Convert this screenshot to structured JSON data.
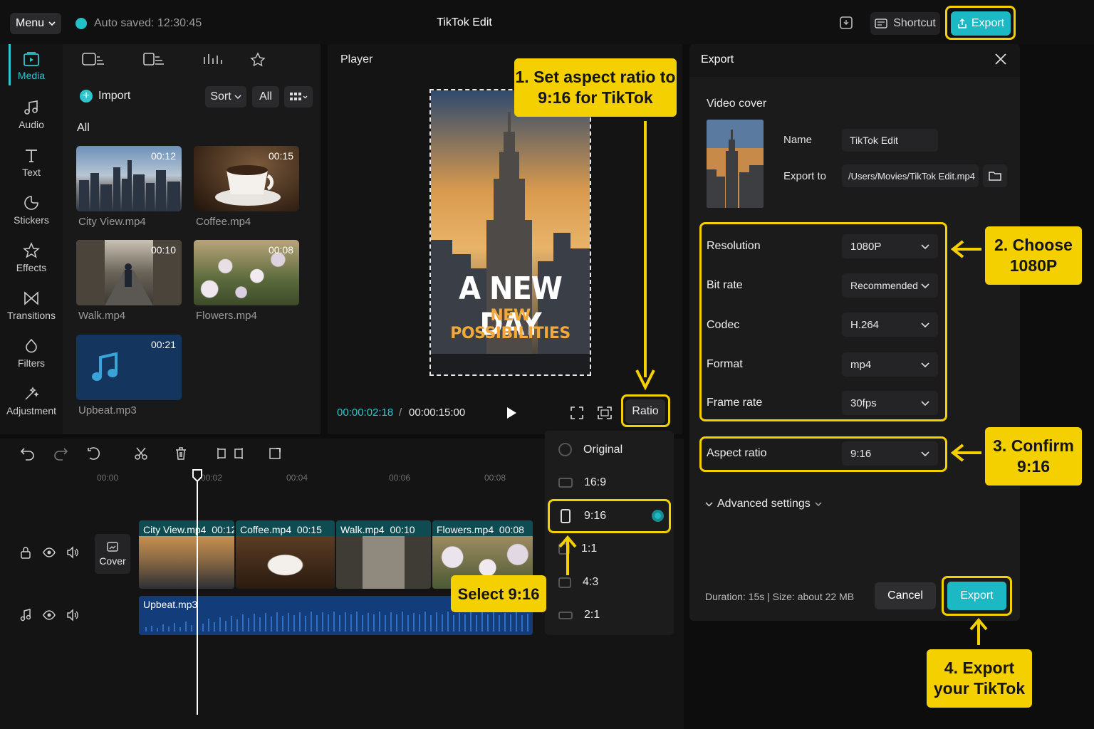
{
  "topbar": {
    "menu_label": "Menu",
    "autosave": "Auto saved: 12:30:45",
    "title": "TikTok Edit",
    "shortcut_label": "Shortcut",
    "export_label": "Export"
  },
  "sidebar": {
    "items": [
      {
        "label": "Media",
        "icon": "media-icon"
      },
      {
        "label": "Audio",
        "icon": "audio-icon"
      },
      {
        "label": "Text",
        "icon": "text-icon"
      },
      {
        "label": "Stickers",
        "icon": "stickers-icon"
      },
      {
        "label": "Effects",
        "icon": "effects-icon"
      },
      {
        "label": "Transitions",
        "icon": "transitions-icon"
      },
      {
        "label": "Filters",
        "icon": "filters-icon"
      },
      {
        "label": "Adjustment",
        "icon": "adjustment-icon"
      }
    ]
  },
  "media": {
    "import_label": "Import",
    "sort_label": "Sort",
    "all_filter": "All",
    "section_label": "All",
    "items": [
      {
        "name": "City View.mp4",
        "duration": "00:12"
      },
      {
        "name": "Coffee.mp4",
        "duration": "00:15"
      },
      {
        "name": "Walk.mp4",
        "duration": "00:10"
      },
      {
        "name": "Flowers.mp4",
        "duration": "00:08"
      },
      {
        "name": "Upbeat.mp3",
        "duration": "00:21"
      }
    ]
  },
  "player": {
    "title": "Player",
    "headline": "A NEW DAY",
    "subline": "NEW POSSIBILITIES",
    "current_time": "00:00:02:18",
    "separator": "/",
    "total_time": "00:00:15:00",
    "ratio_label": "Ratio"
  },
  "ratio_menu": {
    "options": [
      "Original",
      "16:9",
      "9:16",
      "1:1",
      "4:3",
      "2:1"
    ],
    "selected": "9:16"
  },
  "export": {
    "title": "Export",
    "video_cover_label": "Video cover",
    "name_label": "Name",
    "name_value": "TikTok Edit",
    "export_to_label": "Export to",
    "export_to_value": "/Users/Movies/TikTok Edit.mp4",
    "settings": [
      {
        "label": "Resolution",
        "value": "1080P"
      },
      {
        "label": "Bit rate",
        "value": "Recommended"
      },
      {
        "label": "Codec",
        "value": "H.264"
      },
      {
        "label": "Format",
        "value": "mp4"
      },
      {
        "label": "Frame rate",
        "value": "30fps"
      }
    ],
    "aspect_ratio_label": "Aspect ratio",
    "aspect_ratio_value": "9:16",
    "advanced_label": "Advanced settings",
    "summary": "Duration: 15s | Size: about 22 MB",
    "cancel_label": "Cancel",
    "export_label": "Export"
  },
  "timeline": {
    "ruler": [
      "00:00",
      "00:02",
      "00:04",
      "00:06",
      "00:08"
    ],
    "cover_label": "Cover",
    "clips": [
      {
        "name": "City View.mp4",
        "duration": "00:12"
      },
      {
        "name": "Coffee.mp4",
        "duration": "00:15"
      },
      {
        "name": "Walk.mp4",
        "duration": "00:10"
      },
      {
        "name": "Flowers.mp4",
        "duration": "00:08"
      }
    ],
    "audio_clip": "Upbeat.mp3"
  },
  "callouts": {
    "step1": "1. Set aspect ratio to 9:16 for TikTok",
    "step2": "2. Choose 1080P",
    "step3": "3. Confirm 9:16",
    "step4": "4. Export your TikTok",
    "select": "Select 9:16"
  },
  "colors": {
    "accent": "#1cb8c4",
    "highlight": "#f5d000",
    "background": "#0d0d0e"
  }
}
